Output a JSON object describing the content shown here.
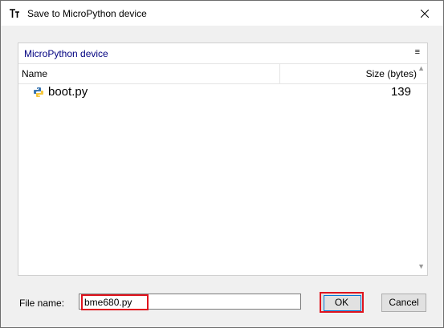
{
  "window": {
    "title": "Save to MicroPython device"
  },
  "panel": {
    "title": "MicroPython device",
    "columns": {
      "name": "Name",
      "size": "Size (bytes)"
    },
    "files": [
      {
        "name": "boot.py",
        "size": "139",
        "icon": "python-file-icon"
      }
    ]
  },
  "footer": {
    "file_name_label": "File name:",
    "file_name_value": "bme680.py",
    "ok_label": "OK",
    "cancel_label": "Cancel"
  },
  "colors": {
    "highlight": "#e0141e",
    "panel_title": "#000080"
  }
}
